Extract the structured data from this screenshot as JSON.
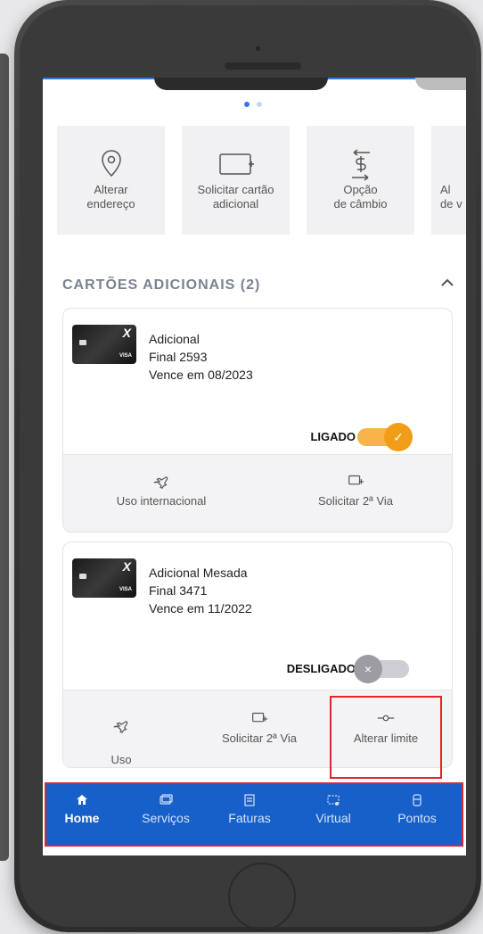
{
  "quick_actions": [
    {
      "label": "Alterar\nendereço",
      "icon": "location-pin-icon"
    },
    {
      "label": "Solicitar cartão\nadicional",
      "icon": "add-card-icon"
    },
    {
      "label": "Opção\nde câmbio",
      "icon": "exchange-icon"
    },
    {
      "label": "Al\nde v",
      "icon": "partial-action-icon"
    }
  ],
  "section": {
    "title": "CARTÕES ADICIONAIS (2)"
  },
  "cards": [
    {
      "name": "Adicional",
      "final": "Final 2593",
      "expiry": "Vence em 08/2023",
      "status": "LIGADO",
      "enabled": true,
      "actions": {
        "international": "Uso internacional",
        "second_copy": "Solicitar 2ª Via"
      }
    },
    {
      "name": "Adicional Mesada",
      "final": "Final 3471",
      "expiry": "Vence em 11/2022",
      "status": "DESLIGADO",
      "enabled": false,
      "actions": {
        "international": "Uso\ninternacional",
        "second_copy": "Solicitar 2ª Via",
        "change_limit": "Alterar limite"
      }
    }
  ],
  "bottom_nav": [
    {
      "label": "Home",
      "icon": "home-icon",
      "active": true
    },
    {
      "label": "Serviços",
      "icon": "services-icon",
      "active": false
    },
    {
      "label": "Faturas",
      "icon": "invoice-icon",
      "active": false
    },
    {
      "label": "Virtual",
      "icon": "virtual-card-icon",
      "active": false
    },
    {
      "label": "Pontos",
      "icon": "points-icon",
      "active": false
    }
  ],
  "colors": {
    "primary": "#1760c9",
    "accent": "#2d7be0",
    "toggle_on": "#f29d18",
    "highlight": "#e0252b"
  }
}
